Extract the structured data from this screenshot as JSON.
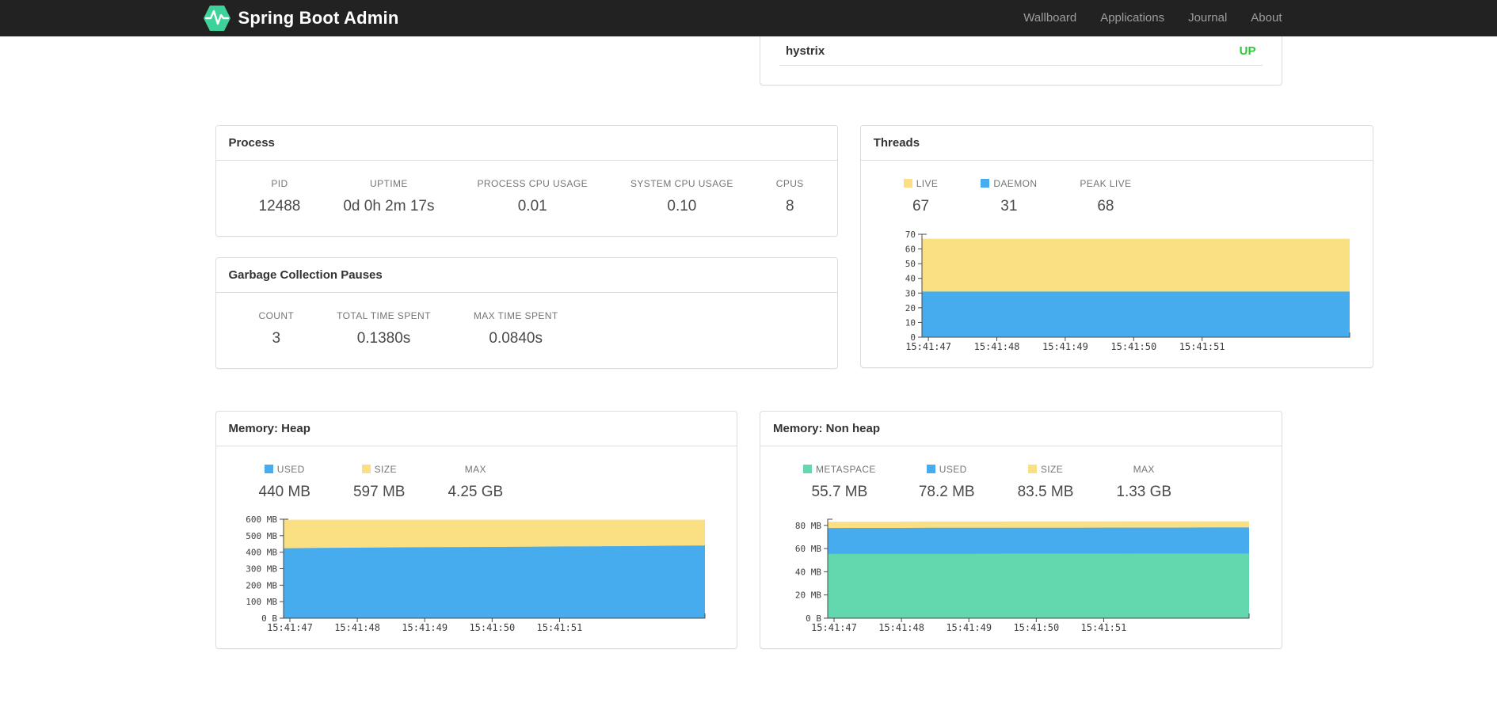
{
  "navbar": {
    "brand": "Spring Boot Admin",
    "links": [
      {
        "label": "Wallboard"
      },
      {
        "label": "Applications"
      },
      {
        "label": "Journal"
      },
      {
        "label": "About"
      }
    ]
  },
  "application": {
    "name": "hystrix",
    "status": "UP",
    "status_color": "#2bc938"
  },
  "process": {
    "title": "Process",
    "metrics": [
      {
        "label": "PID",
        "value": "12488"
      },
      {
        "label": "UPTIME",
        "value": "0d 0h 2m 17s"
      },
      {
        "label": "PROCESS CPU USAGE",
        "value": "0.01"
      },
      {
        "label": "SYSTEM CPU USAGE",
        "value": "0.10"
      },
      {
        "label": "CPUS",
        "value": "8"
      }
    ]
  },
  "gc": {
    "title": "Garbage Collection Pauses",
    "metrics": [
      {
        "label": "COUNT",
        "value": "3"
      },
      {
        "label": "TOTAL TIME SPENT",
        "value": "0.1380s"
      },
      {
        "label": "MAX TIME SPENT",
        "value": "0.0840s"
      }
    ]
  },
  "threads": {
    "title": "Threads",
    "metrics": [
      {
        "label": "LIVE",
        "value": "67",
        "color": "#fbe083"
      },
      {
        "label": "DAEMON",
        "value": "31",
        "color": "#47aced"
      },
      {
        "label": "PEAK LIVE",
        "value": "68"
      }
    ]
  },
  "memory_heap": {
    "title": "Memory: Heap",
    "metrics": [
      {
        "label": "USED",
        "value": "440 MB",
        "color": "#47aced"
      },
      {
        "label": "SIZE",
        "value": "597 MB",
        "color": "#fbe083"
      },
      {
        "label": "MAX",
        "value": "4.25 GB"
      }
    ]
  },
  "memory_nonheap": {
    "title": "Memory: Non heap",
    "metrics": [
      {
        "label": "METASPACE",
        "value": "55.7 MB",
        "color": "#63d7ae"
      },
      {
        "label": "USED",
        "value": "78.2 MB",
        "color": "#47aced"
      },
      {
        "label": "SIZE",
        "value": "83.5 MB",
        "color": "#fbe083"
      },
      {
        "label": "MAX",
        "value": "1.33 GB"
      }
    ]
  },
  "logo_color": "#3ed29b",
  "chart_data": [
    {
      "type": "area",
      "title": "Threads",
      "x_labels": [
        "15:41:47",
        "15:41:48",
        "15:41:49",
        "15:41:50",
        "15:41:51"
      ],
      "ymax": 70,
      "y_ticks": [
        {
          "v": 0,
          "label": "0"
        },
        {
          "v": 10,
          "label": "10"
        },
        {
          "v": 20,
          "label": "20"
        },
        {
          "v": 30,
          "label": "30"
        },
        {
          "v": 40,
          "label": "40"
        },
        {
          "v": 50,
          "label": "50"
        },
        {
          "v": 60,
          "label": "60"
        },
        {
          "v": 70,
          "label": "70"
        }
      ],
      "series": [
        {
          "name": "LIVE",
          "color": "#fbe083",
          "values": [
            67,
            67,
            67,
            67,
            67,
            67,
            67,
            67,
            67,
            67,
            67,
            67,
            67
          ]
        },
        {
          "name": "DAEMON",
          "color": "#47aced",
          "values": [
            31,
            31,
            31,
            31,
            31,
            31,
            31,
            31,
            31,
            31,
            31,
            31,
            31
          ]
        }
      ]
    },
    {
      "type": "area",
      "title": "Memory: Heap",
      "x_labels": [
        "15:41:47",
        "15:41:48",
        "15:41:49",
        "15:41:50",
        "15:41:51"
      ],
      "ymax": 600,
      "y_ticks": [
        {
          "v": 0,
          "label": "0 B"
        },
        {
          "v": 100,
          "label": "100 MB"
        },
        {
          "v": 200,
          "label": "200 MB"
        },
        {
          "v": 300,
          "label": "300 MB"
        },
        {
          "v": 400,
          "label": "400 MB"
        },
        {
          "v": 500,
          "label": "500 MB"
        },
        {
          "v": 600,
          "label": "600 MB"
        }
      ],
      "series": [
        {
          "name": "SIZE",
          "color": "#fbe083",
          "values": [
            597,
            597,
            597,
            597,
            597,
            597,
            597,
            597,
            597,
            597,
            597,
            597,
            597
          ]
        },
        {
          "name": "USED",
          "color": "#47aced",
          "values": [
            424,
            426,
            427,
            429,
            430,
            431,
            432,
            433,
            435,
            436,
            437,
            439,
            440
          ]
        }
      ]
    },
    {
      "type": "area",
      "title": "Memory: Non heap",
      "x_labels": [
        "15:41:47",
        "15:41:48",
        "15:41:49",
        "15:41:50",
        "15:41:51"
      ],
      "ymax": 85.3,
      "y_ticks": [
        {
          "v": 0,
          "label": "0 B"
        },
        {
          "v": 20,
          "label": "20 MB"
        },
        {
          "v": 40,
          "label": "40 MB"
        },
        {
          "v": 60,
          "label": "60 MB"
        },
        {
          "v": 80,
          "label": "80 MB"
        }
      ],
      "series": [
        {
          "name": "SIZE",
          "color": "#fbe083",
          "values": [
            83.1,
            83.2,
            83.2,
            83.3,
            83.3,
            83.3,
            83.4,
            83.4,
            83.4,
            83.5,
            83.5,
            83.5,
            83.5
          ]
        },
        {
          "name": "USED",
          "color": "#47aced",
          "values": [
            77.7,
            77.8,
            77.8,
            77.9,
            77.9,
            78.0,
            78.0,
            78.0,
            78.1,
            78.1,
            78.1,
            78.2,
            78.2
          ]
        },
        {
          "name": "METASPACE",
          "color": "#63d7ae",
          "values": [
            55.4,
            55.4,
            55.5,
            55.5,
            55.5,
            55.6,
            55.6,
            55.6,
            55.6,
            55.7,
            55.7,
            55.7,
            55.7
          ]
        }
      ]
    }
  ]
}
